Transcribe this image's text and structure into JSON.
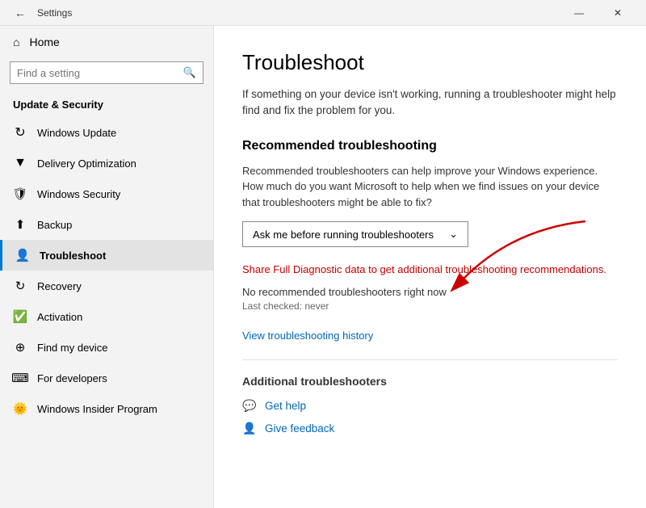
{
  "titlebar": {
    "title": "Settings",
    "minimize_label": "—",
    "close_label": "✕"
  },
  "sidebar": {
    "home_label": "Home",
    "search_placeholder": "Find a setting",
    "section_label": "Update & Security",
    "items": [
      {
        "id": "windows-update",
        "label": "Windows Update",
        "icon": "↻",
        "active": false
      },
      {
        "id": "delivery-optimization",
        "label": "Delivery Optimization",
        "icon": "↓",
        "active": false
      },
      {
        "id": "windows-security",
        "label": "Windows Security",
        "icon": "🛡",
        "active": false
      },
      {
        "id": "backup",
        "label": "Backup",
        "icon": "↑",
        "active": false
      },
      {
        "id": "troubleshoot",
        "label": "Troubleshoot",
        "icon": "👤",
        "active": true
      },
      {
        "id": "recovery",
        "label": "Recovery",
        "icon": "↺",
        "active": false
      },
      {
        "id": "activation",
        "label": "Activation",
        "icon": "☑",
        "active": false
      },
      {
        "id": "find-my-device",
        "label": "Find my device",
        "icon": "⊕",
        "active": false
      },
      {
        "id": "for-developers",
        "label": "For developers",
        "icon": "⌨",
        "active": false
      },
      {
        "id": "windows-insider",
        "label": "Windows Insider Program",
        "icon": "🪟",
        "active": false
      }
    ]
  },
  "main": {
    "page_title": "Troubleshoot",
    "page_desc": "If something on your device isn't working, running a troubleshooter might help find and fix the problem for you.",
    "recommended_section": {
      "title": "Recommended troubleshooting",
      "desc": "Recommended troubleshooters can help improve your Windows experience. How much do you want Microsoft to help when we find issues on your device that troubleshooters might be able to fix?",
      "dropdown_label": "Ask me before running troubleshooters",
      "link_red": "Share Full Diagnostic data to get additional troubleshooting recommendations.",
      "status_text": "No recommended troubleshooters right now",
      "status_subtext": "Last checked: never"
    },
    "view_history_link": "View troubleshooting history",
    "additional_section": {
      "title": "Additional troubleshooters"
    },
    "links": [
      {
        "id": "get-help",
        "label": "Get help",
        "icon": "💬"
      },
      {
        "id": "give-feedback",
        "label": "Give feedback",
        "icon": "👤"
      }
    ]
  }
}
